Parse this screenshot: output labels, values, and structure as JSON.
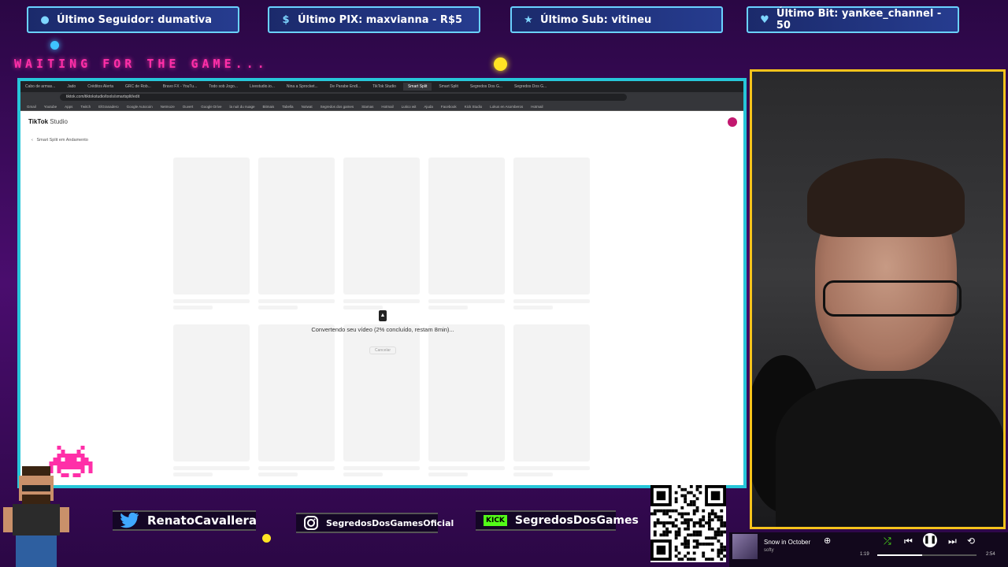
{
  "overlay": {
    "tickers": [
      {
        "icon": "user-icon",
        "label": "Último Seguidor: dumativa"
      },
      {
        "icon": "dollar-icon",
        "label": "Último PIX: maxvianna - R$5"
      },
      {
        "icon": "star-icon",
        "label": "Último Sub: vitineu"
      },
      {
        "icon": "heart-icon",
        "label": "Último Bit: yankee_channel - 50"
      }
    ],
    "waiting_text": "WAITING FOR THE GAME..."
  },
  "browser": {
    "tabs": [
      "Cabo de armas...",
      "Jado",
      "Créditos Alerta",
      "GRC de Rob...",
      "Bravo FX - YouTu...",
      "Todo sob Jogo...",
      "Livestudio.io...",
      "Nina a Sprocket...",
      "De Parabe Endl...",
      "TikTok Studio",
      "Smart Split",
      "Smart Split",
      "Segredos Dos G...",
      "Segredos Dos G..."
    ],
    "active_tab": "Smart Split",
    "url": "tiktok.com/tiktokstudio/tools/smartsplit/edit",
    "bookmarks": [
      "Gmail",
      "Youtube",
      "Apps",
      "Twitch",
      "ElGranadero",
      "Google Autocoin",
      "Netmoze",
      "Ouvert",
      "Google Drive",
      "la nuit du nuage",
      "Bitmais",
      "Tabella",
      "Notwat",
      "Segredos dos games",
      "Stamas",
      "Hotmail",
      "Lutico wit",
      "Ajuda",
      "Facebook",
      "Kick Studio",
      "Lokus en Asomberos",
      "Hotmail"
    ],
    "page": {
      "logo": "TikTok",
      "logo_sub": "Studio",
      "back_label": "Smart Split em Andamento",
      "converting_text": "Convertendo seu vídeo (2% concluído, restam 8min)...",
      "cancel_label": "Cancelar"
    }
  },
  "socials": [
    {
      "icon": "twitter-icon",
      "label": "RenatoCavallera"
    },
    {
      "icon": "instagram-icon",
      "label": "SegredosDosGamesOficial"
    },
    {
      "icon": "kick-icon",
      "badge": "KICK",
      "label": "SegredosDosGames"
    }
  ],
  "qr": {
    "url": "livepix.gg/segredosdosgames"
  },
  "player": {
    "song": "Snow in October",
    "artist": "softy",
    "elapsed": "1:19",
    "duration": "2:54",
    "progress": 0.45
  },
  "colors": {
    "accent": "#27c6d9",
    "cam_border": "#f6c31c",
    "waiting": "#ff2fa8",
    "background": "#3b0a5c"
  }
}
